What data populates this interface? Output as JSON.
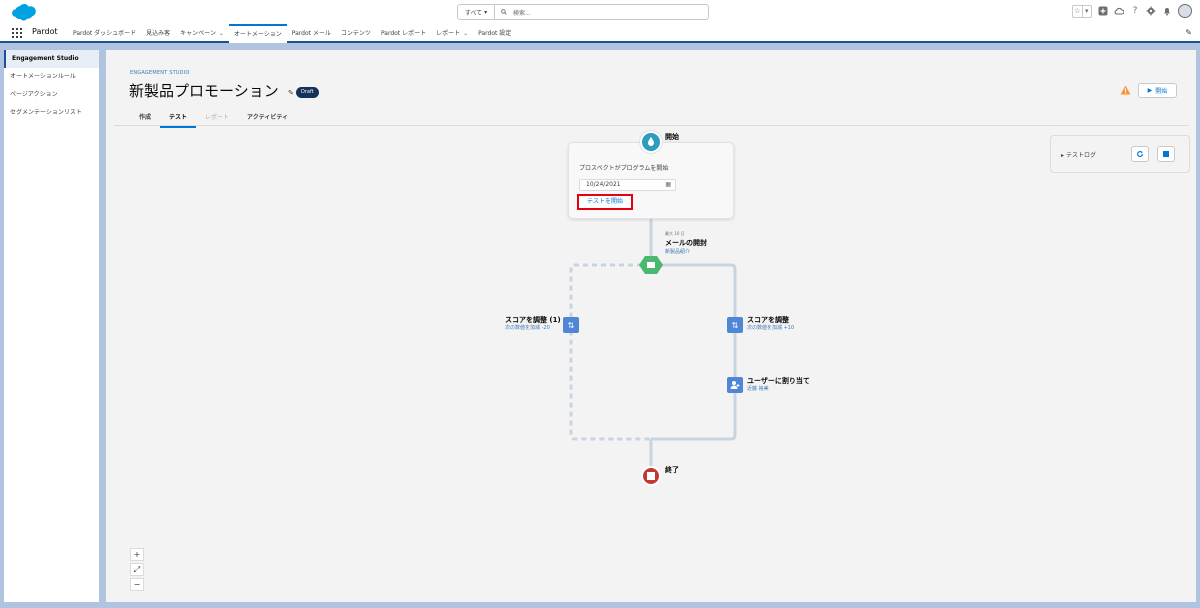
{
  "header": {
    "search_scope": "すべて",
    "search_placeholder": "検索...",
    "icons": [
      "favorites-star-icon",
      "favorites-list-icon",
      "add-icon",
      "cloud-icon",
      "help-icon",
      "setup-gear-icon",
      "notifications-bell-icon",
      "avatar"
    ]
  },
  "nav": {
    "app_name": "Pardot",
    "items": [
      {
        "label": "Pardot ダッシュボード",
        "dropdown": false
      },
      {
        "label": "見込み客",
        "dropdown": false
      },
      {
        "label": "キャンペーン",
        "dropdown": true
      },
      {
        "label": "オートメーション",
        "dropdown": false,
        "active": true
      },
      {
        "label": "Pardot メール",
        "dropdown": false
      },
      {
        "label": "コンテンツ",
        "dropdown": false
      },
      {
        "label": "Pardot レポート",
        "dropdown": false
      },
      {
        "label": "レポート",
        "dropdown": true
      },
      {
        "label": "Pardot 設定",
        "dropdown": false
      }
    ]
  },
  "sidebar": {
    "items": [
      {
        "label": "Engagement Studio",
        "active": true
      },
      {
        "label": "オートメーションルール"
      },
      {
        "label": "ページアクション"
      },
      {
        "label": "セグメンテーションリスト"
      }
    ]
  },
  "page": {
    "eyebrow": "ENGAGEMENT STUDIO",
    "title": "新製品プロモーション",
    "badge": "Draft",
    "start_button": "開始",
    "tabs": [
      {
        "label": "作成"
      },
      {
        "label": "テスト",
        "active": true
      },
      {
        "label": "レポート",
        "disabled": true
      },
      {
        "label": "アクティビティ"
      }
    ]
  },
  "flow": {
    "start_label": "開始",
    "start_sub": "",
    "start_card_label": "プロスペクトがプログラムを開始",
    "date_value": "10/24/2021",
    "test_button": "テストを開始",
    "email_wait": "最大 10 日",
    "email_title": "メールの開封",
    "email_sub": "新製品紹介",
    "left_action_title": "スコアを調整 (1)",
    "left_action_sub": "次の数値を加減 -20",
    "right_action_title": "スコアを調整",
    "right_action_sub": "次の数値を加減 +10",
    "assign_title": "ユーザーに割り当て",
    "assign_sub": "近藤 裕美",
    "end_label": "終了"
  },
  "test_log": {
    "label": "テストログ"
  },
  "zoom": {
    "plus": "+",
    "fit": "⤢",
    "minus": "−"
  },
  "colors": {
    "accent": "#0176d3",
    "nav_border": "#1b5297",
    "start_node": "#2d9cbf",
    "email_node": "#4bb872",
    "action_node": "#4f86d6",
    "end_node": "#c23934",
    "highlight": "#e60012"
  }
}
